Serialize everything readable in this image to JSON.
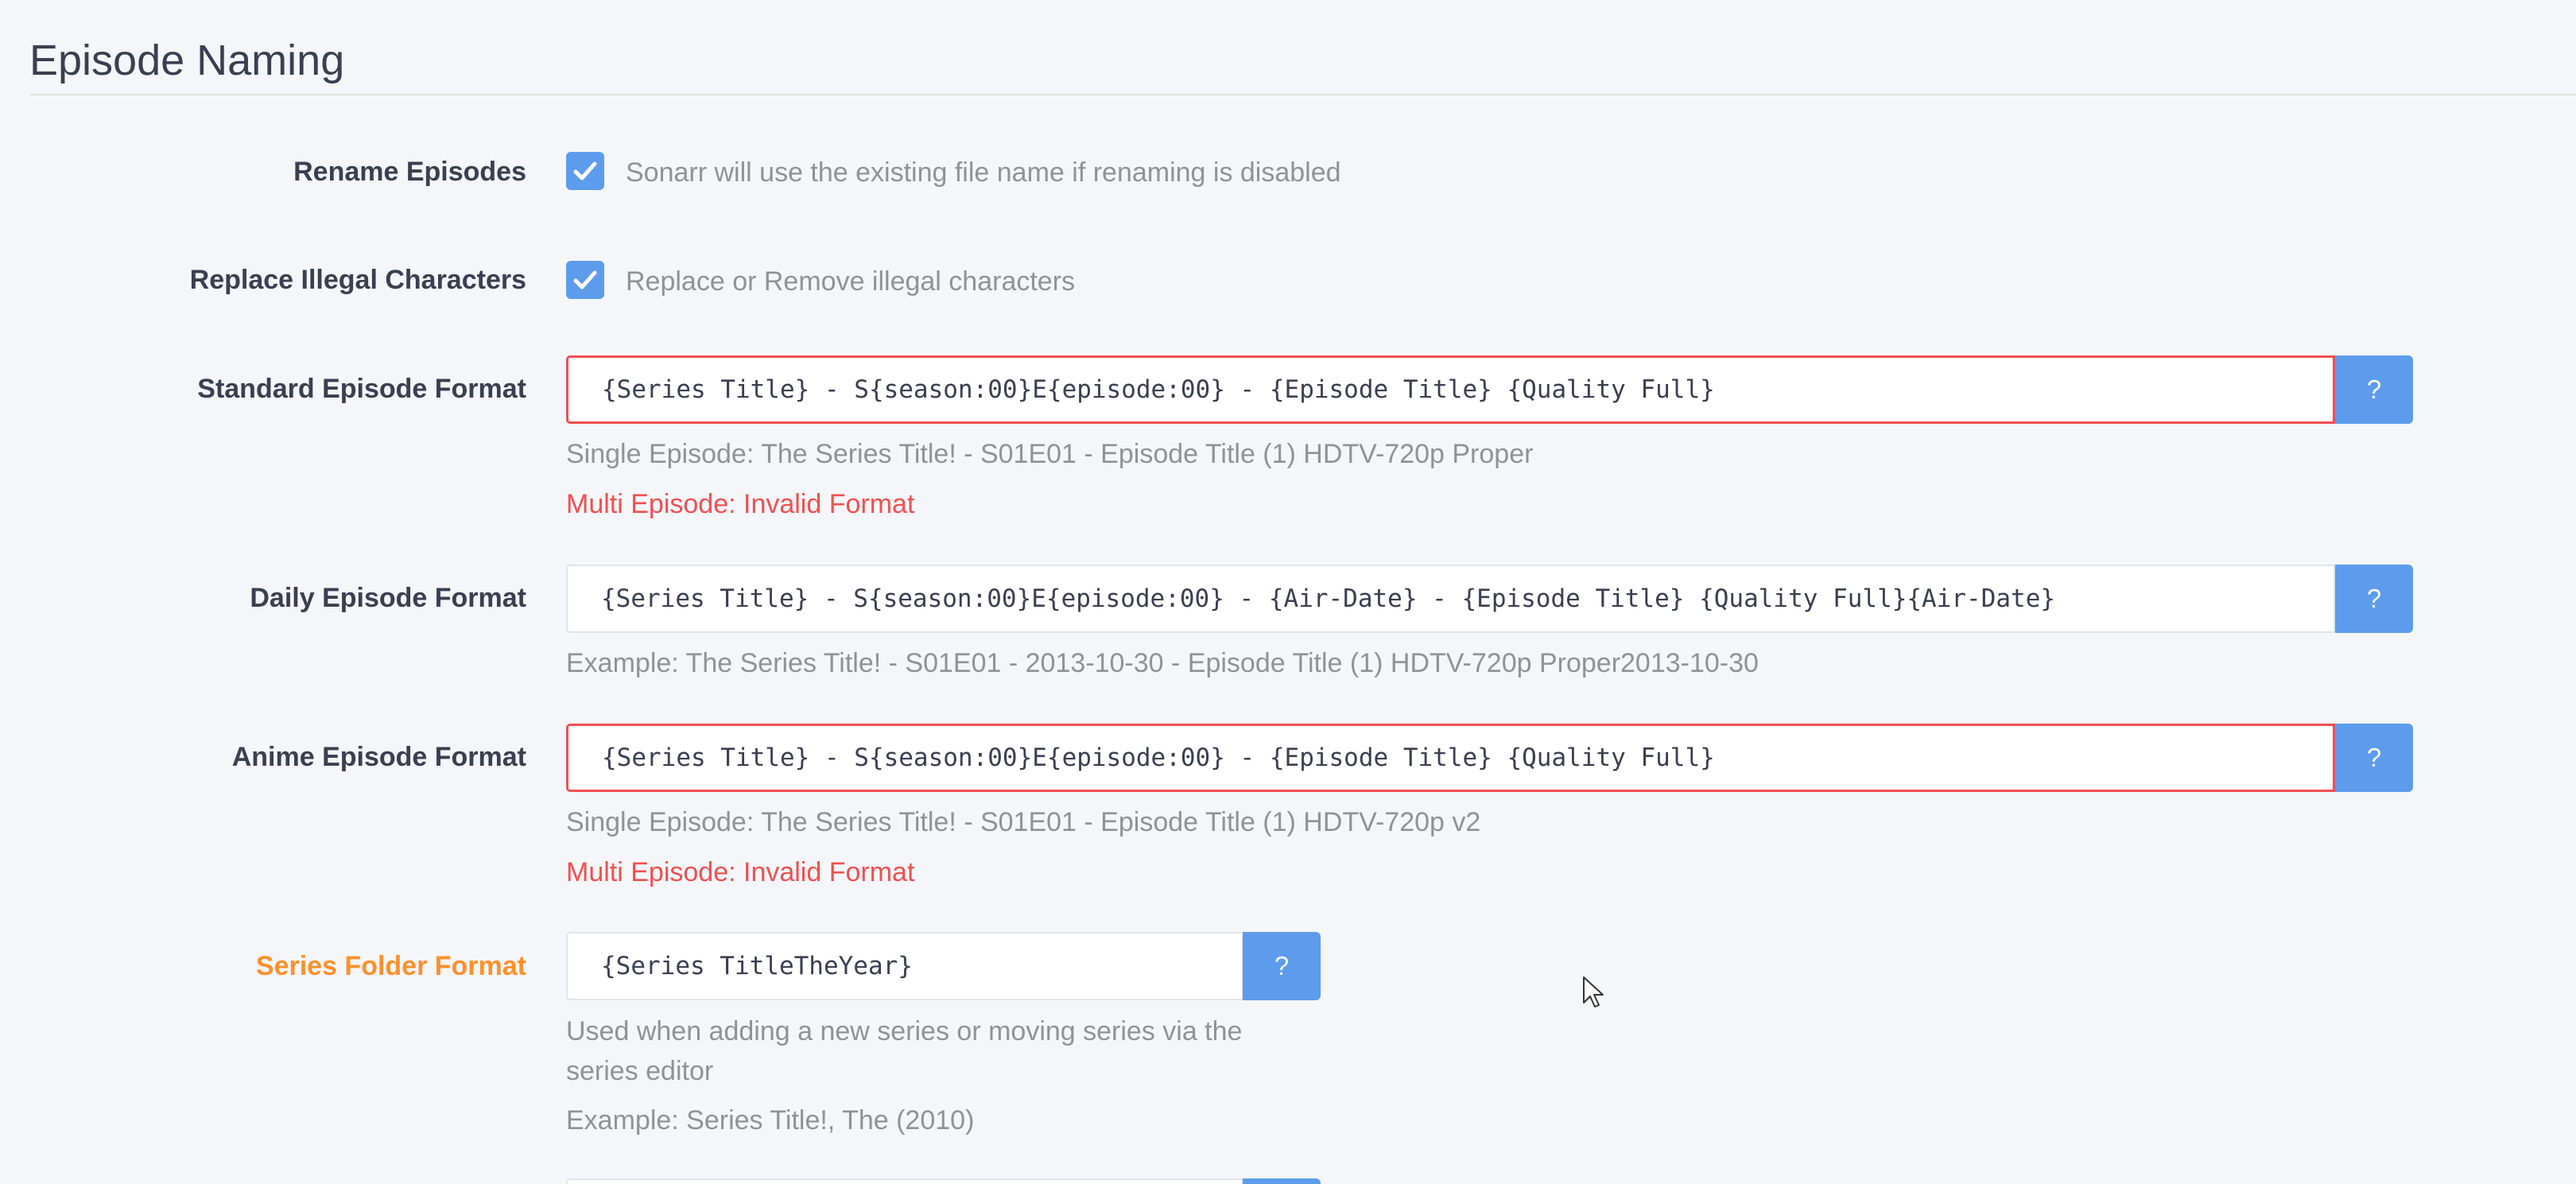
{
  "section": {
    "title": "Episode Naming"
  },
  "rename": {
    "label": "Rename Episodes",
    "checked": true,
    "help": "Sonarr will use the existing file name if renaming is disabled"
  },
  "replace_illegal": {
    "label": "Replace Illegal Characters",
    "checked": true,
    "help": "Replace or Remove illegal characters"
  },
  "standard": {
    "label": "Standard Episode Format",
    "value": "{Series Title} - S{season:00}E{episode:00} - {Episode Title} {Quality Full}",
    "single_example": "Single Episode: The Series Title! - S01E01 - Episode Title (1) HDTV-720p Proper",
    "multi_example": "Multi Episode: Invalid Format",
    "help_button": "?"
  },
  "daily": {
    "label": "Daily Episode Format",
    "value": "{Series Title} - S{season:00}E{episode:00} - {Air-Date} - {Episode Title} {Quality Full}{Air-Date}",
    "example": "Example: The Series Title! - S01E01 - 2013-10-30 - Episode Title (1) HDTV-720p Proper2013-10-30",
    "help_button": "?"
  },
  "anime": {
    "label": "Anime Episode Format",
    "value": "{Series Title} - S{season:00}E{episode:00} - {Episode Title} {Quality Full}",
    "single_example": "Single Episode: The Series Title! - S01E01 - Episode Title (1) HDTV-720p v2",
    "multi_example": "Multi Episode: Invalid Format",
    "help_button": "?"
  },
  "series_folder": {
    "label": "Series Folder Format",
    "value": "{Series TitleTheYear}",
    "help": "Used when adding a new series or moving series via the series editor",
    "example": "Example: Series Title!, The (2010)",
    "help_button": "?"
  },
  "colors": {
    "accent": "#5d9cec",
    "error": "#f05050",
    "warning": "#ff902b",
    "text": "#3a3f51",
    "muted": "#909293"
  }
}
